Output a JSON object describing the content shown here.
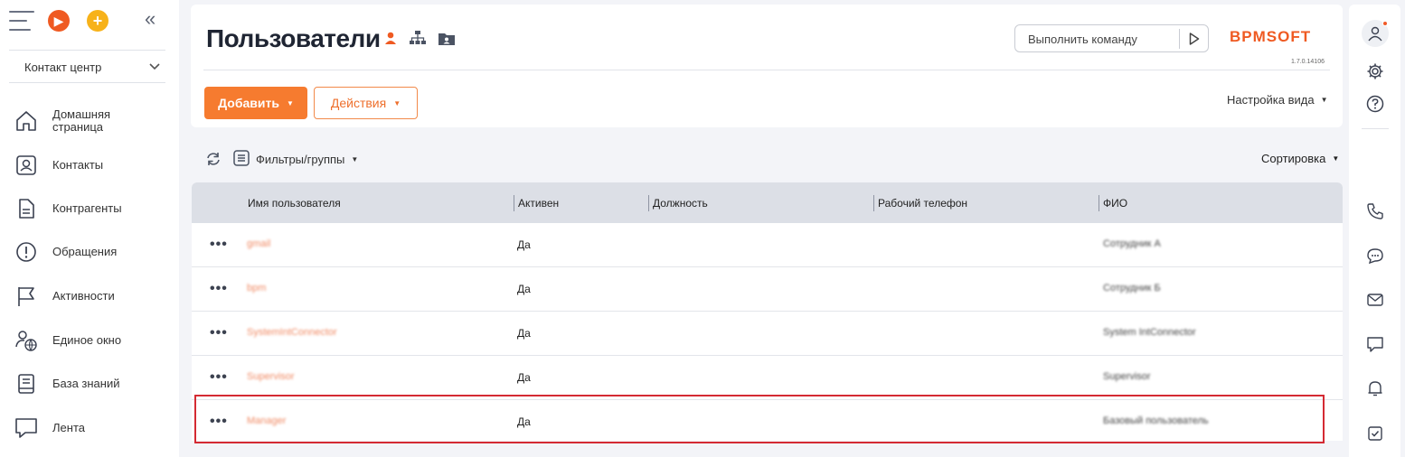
{
  "sidebar": {
    "workplace": "Контакт центр",
    "items": [
      {
        "label": "Домашняя страница",
        "icon": "home-icon"
      },
      {
        "label": "Контакты",
        "icon": "contact-card-icon"
      },
      {
        "label": "Контрагенты",
        "icon": "document-icon"
      },
      {
        "label": "Обращения",
        "icon": "alert-circle-icon"
      },
      {
        "label": "Активности",
        "icon": "flag-icon"
      },
      {
        "label": "Единое окно",
        "icon": "user-globe-icon"
      },
      {
        "label": "База знаний",
        "icon": "book-icon"
      },
      {
        "label": "Лента",
        "icon": "chat-bubble-icon"
      }
    ]
  },
  "header": {
    "title": "Пользователи",
    "command_placeholder": "Выполнить команду",
    "logo": "BPMSOFT",
    "version": "1.7.0.14106",
    "add_label": "Добавить",
    "actions_label": "Действия",
    "view_settings_label": "Настройка вида"
  },
  "toolbar": {
    "filters_label": "Фильтры/группы",
    "sorting_label": "Сортировка"
  },
  "grid": {
    "columns": [
      "Имя пользователя",
      "Активен",
      "Должность",
      "Рабочий телефон",
      "ФИО"
    ],
    "rows": [
      {
        "login": "gmail",
        "active": "Да",
        "position": "",
        "phone": "",
        "fio": "Сотрудник А"
      },
      {
        "login": "bpm",
        "active": "Да",
        "position": "",
        "phone": "",
        "fio": "Сотрудник Б"
      },
      {
        "login": "SystemIntConnector",
        "active": "Да",
        "position": "",
        "phone": "",
        "fio": "System IntConnector"
      },
      {
        "login": "Supervisor",
        "active": "Да",
        "position": "",
        "phone": "",
        "fio": "Supervisor"
      },
      {
        "login": "Manager",
        "active": "Да",
        "position": "",
        "phone": "",
        "fio": "Базовый пользователь"
      }
    ]
  },
  "colors": {
    "accent": "#f67b2f",
    "highlight": "#d42a33"
  }
}
